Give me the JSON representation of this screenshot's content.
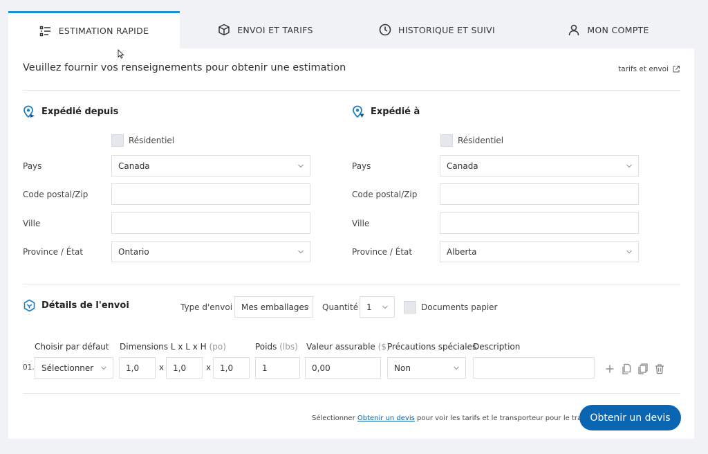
{
  "tabs": [
    {
      "label": "ESTIMATION RAPIDE",
      "icon": "list-icon",
      "active": true
    },
    {
      "label": "ENVOI ET TARIFS",
      "icon": "box-icon",
      "active": false
    },
    {
      "label": "HISTORIQUE ET SUIVI",
      "icon": "clock-icon",
      "active": false
    },
    {
      "label": "MON COMPTE",
      "icon": "user-icon",
      "active": false
    }
  ],
  "header": {
    "title": "Veuillez fournir vos renseignements pour obtenir une estimation",
    "link_label": "tarifs et envoi"
  },
  "from": {
    "title": "Expédié depuis",
    "residential_label": "Résidentiel",
    "country_label": "Pays",
    "country_value": "Canada",
    "postal_label": "Code postal/Zip",
    "postal_value": "",
    "city_label": "Ville",
    "city_value": "",
    "province_label": "Province / État",
    "province_value": "Ontario"
  },
  "to": {
    "title": "Expédié à",
    "residential_label": "Résidentiel",
    "country_label": "Pays",
    "country_value": "Canada",
    "postal_label": "Code postal/Zip",
    "postal_value": "",
    "city_label": "Ville",
    "city_value": "",
    "province_label": "Province / État",
    "province_value": "Alberta"
  },
  "details": {
    "title": "Détails de l'envoi",
    "type_label": "Type d'envoi",
    "type_value": "Mes emballages",
    "qty_label": "Quantité",
    "qty_value": "1",
    "docs_label": "Documents papier"
  },
  "columns": {
    "default": "Choisir par défaut",
    "dimensions": "Dimensions L x L x H",
    "dimensions_unit": "(po)",
    "weight": "Poids",
    "weight_unit": "(lbs)",
    "insured": "Valeur assurable",
    "insured_unit": "($)",
    "precautions": "Précautions spéciales",
    "description": "Description"
  },
  "row": {
    "index": "01.",
    "default_value": "Sélectionner",
    "length": "1,0",
    "width": "1,0",
    "height": "1,0",
    "times": "x",
    "weight": "1",
    "insured": "0,00",
    "precautions": "Non",
    "description": ""
  },
  "footer": {
    "pre": "Sélectionner",
    "link": "Obtenir un devis",
    "post": "pour voir les tarifs et le transporteur pour le trajet choisi",
    "cta": "Obtenir un devis"
  },
  "colors": {
    "accent": "#1a8fd1",
    "primary_button": "#0a66b2",
    "link": "#0a5ea8"
  }
}
